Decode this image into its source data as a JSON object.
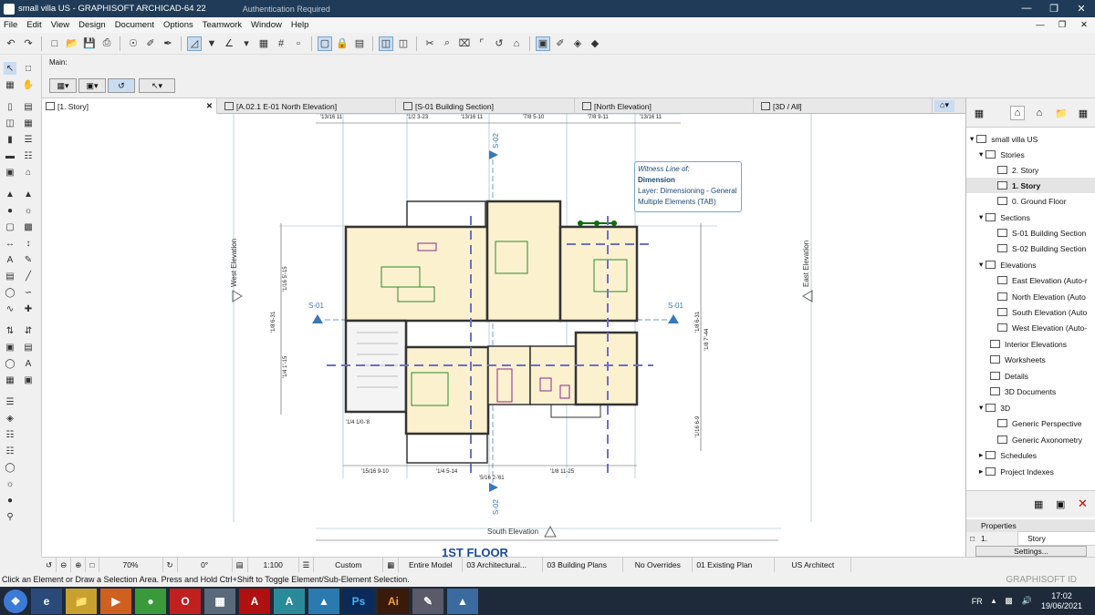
{
  "window": {
    "title": "small villa US - GRAPHISOFT ARCHICAD-64 22",
    "other_tab_1": "",
    "other_tab_2": "Authentication Required"
  },
  "menu": [
    "File",
    "Edit",
    "View",
    "Design",
    "Document",
    "Options",
    "Teamwork",
    "Window",
    "Help"
  ],
  "infobox": {
    "main_label": "Main:"
  },
  "view_tabs": [
    {
      "label": "[1. Story]",
      "active": true
    },
    {
      "label": "[A.02.1 E-01 North Elevation]",
      "active": false
    },
    {
      "label": "[S-01 Building Section]",
      "active": false
    },
    {
      "label": "[North Elevation]",
      "active": false
    },
    {
      "label": "[3D / All]",
      "active": false
    }
  ],
  "drawing": {
    "west_elevation": "West Elevation",
    "east_elevation": "East Elevation",
    "south_elevation": "South Elevation",
    "section_left": "S-01",
    "section_right": "S-01",
    "section_top": "S-02",
    "section_bottom": "S-02",
    "floor_title": "1ST FLOOR",
    "dims_top": [
      "'13/16 11",
      "'1/2 3-23",
      "'13/16 11",
      "'7/8 5-10",
      "'7/8 9-11",
      "'13/16 11"
    ],
    "dims_bottom": [
      "'15/16 9-10",
      "'1/4 5-14",
      "'5/16 2-'61",
      "'1/8 11-25"
    ],
    "dims_left": [
      "'1/16 5'-15",
      "'1/8 6-31",
      "'1/4 1'-15"
    ],
    "dims_right": [
      "'1/8 6-31",
      "'1/8 7'-44",
      "'1/16 6-9"
    ],
    "dim_misc": "'1/4 1/0-'8"
  },
  "tooltip": {
    "line1": "Witness Line of:",
    "line2": "Dimension",
    "line3": "Layer: Dimensioning - General",
    "line4": "Multiple Elements (TAB)"
  },
  "navigator": {
    "items": [
      {
        "label": "small villa US",
        "level": 0
      },
      {
        "label": "Stories",
        "level": 1
      },
      {
        "label": "2. Story",
        "level": 2
      },
      {
        "label": "1. Story",
        "level": 2,
        "selected": true
      },
      {
        "label": "0. Ground Floor",
        "level": 2
      },
      {
        "label": "Sections",
        "level": 1
      },
      {
        "label": "S-01 Building Section",
        "level": 2
      },
      {
        "label": "S-02 Building Section",
        "level": 2
      },
      {
        "label": "Elevations",
        "level": 1
      },
      {
        "label": "East Elevation (Auto-r",
        "level": 2
      },
      {
        "label": "North Elevation (Auto",
        "level": 2
      },
      {
        "label": "South Elevation (Auto",
        "level": 2
      },
      {
        "label": "West Elevation (Auto-",
        "level": 2
      },
      {
        "label": "Interior Elevations",
        "level": 1
      },
      {
        "label": "Worksheets",
        "level": 1
      },
      {
        "label": "Details",
        "level": 1
      },
      {
        "label": "3D Documents",
        "level": 1
      },
      {
        "label": "3D",
        "level": 1
      },
      {
        "label": "Generic Perspective",
        "level": 2
      },
      {
        "label": "Generic Axonometry",
        "level": 2
      },
      {
        "label": "Schedules",
        "level": 1
      },
      {
        "label": "Project Indexes",
        "level": 1
      }
    ]
  },
  "properties": {
    "header": "Properties",
    "story_num": "1.",
    "story_name": "Story",
    "settings": "Settings..."
  },
  "statusbar": {
    "zoom": "70%",
    "angle": "0°",
    "scale": "1:100",
    "layer_combo": "Custom",
    "model_view": "Entire Model",
    "pen_set": "03 Architectural...",
    "mvo": "03 Building Plans",
    "override": "No Overrides",
    "renovation": "01 Existing Plan",
    "dimension": "US Architect"
  },
  "hint": "Click an Element or Draw a Selection Area. Press and Hold Ctrl+Shift to Toggle Element/Sub-Element Selection.",
  "brand": "GRAPHISOFT ID",
  "taskbar": {
    "lang": "FR",
    "time": "17:02",
    "date": "19/06/2021"
  }
}
